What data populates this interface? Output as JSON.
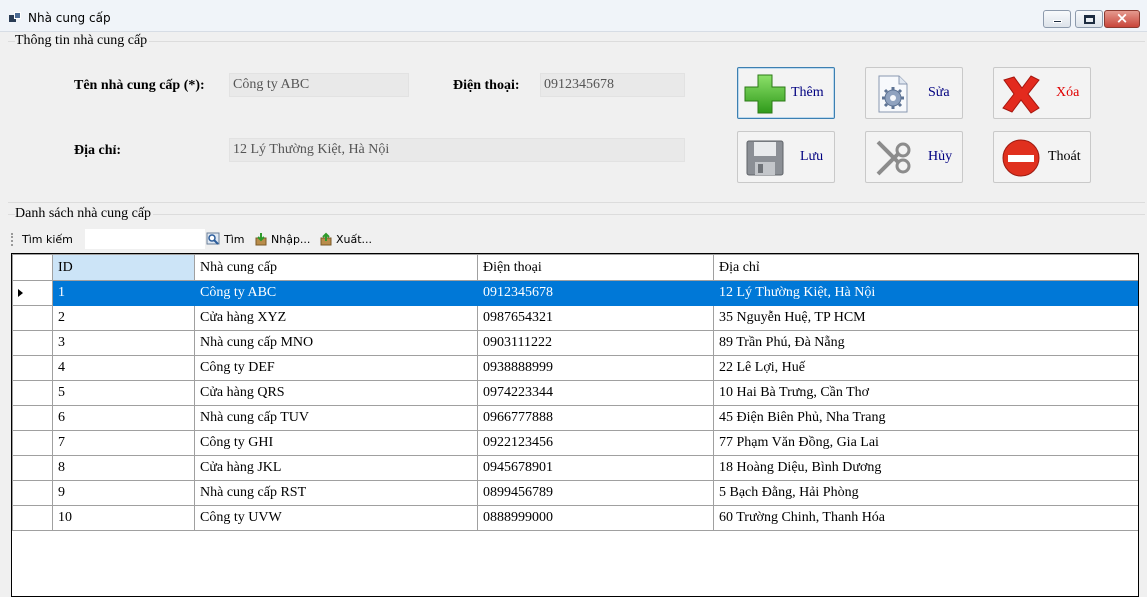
{
  "window": {
    "title": "Nhà cung cấp"
  },
  "info_group": {
    "legend": "Thông tin nhà cung cấp",
    "name_label": "Tên nhà cung cấp (*):",
    "name_value": "Công ty ABC",
    "phone_label": "Điện thoại:",
    "phone_value": "0912345678",
    "address_label": "Địa chỉ:",
    "address_value": "12 Lý Thường Kiệt, Hà Nội"
  },
  "buttons": {
    "add": "Thêm",
    "edit": "Sửa",
    "delete": "Xóa",
    "save": "Lưu",
    "cancel": "Hủy",
    "exit": "Thoát"
  },
  "colors": {
    "selection": "#0078d7",
    "header_selected": "#cce4f7",
    "delete_text": "#e00000",
    "button_text_blue": "#000080"
  },
  "list_group": {
    "legend": "Danh sách nhà cung cấp",
    "toolbar": {
      "search_label": "Tìm kiếm",
      "search_button": "Tìm",
      "import_button": "Nhập...",
      "export_button": "Xuất..."
    },
    "columns": [
      "ID",
      "Nhà cung cấp",
      "Điện thoại",
      "Địa chỉ"
    ],
    "rows": [
      [
        "1",
        "Công ty ABC",
        "0912345678",
        "12 Lý Thường Kiệt, Hà Nội"
      ],
      [
        "2",
        "Cửa hàng XYZ",
        "0987654321",
        "35 Nguyễn Huệ, TP HCM"
      ],
      [
        "3",
        "Nhà cung cấp MNO",
        "0903111222",
        "89 Trần Phú, Đà Nẵng"
      ],
      [
        "4",
        "Công ty DEF",
        "0938888999",
        "22 Lê Lợi, Huế"
      ],
      [
        "5",
        "Cửa hàng QRS",
        "0974223344",
        "10 Hai Bà Trưng, Cần Thơ"
      ],
      [
        "6",
        "Nhà cung cấp TUV",
        "0966777888",
        "45 Điện Biên Phủ, Nha Trang"
      ],
      [
        "7",
        "Công ty GHI",
        "0922123456",
        "77 Phạm Văn Đồng, Gia Lai"
      ],
      [
        "8",
        "Cửa hàng JKL",
        "0945678901",
        "18 Hoàng Diệu, Bình Dương"
      ],
      [
        "9",
        "Nhà cung cấp RST",
        "0899456789",
        "5 Bạch Đằng, Hải Phòng"
      ],
      [
        "10",
        "Công ty UVW",
        "0888999000",
        "60 Trường Chinh, Thanh Hóa"
      ]
    ]
  }
}
